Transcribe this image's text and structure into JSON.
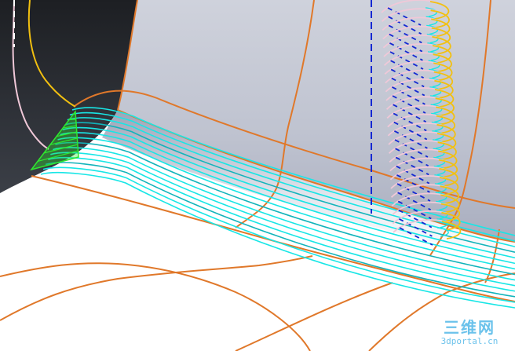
{
  "viewport": {
    "background": "#ffffff",
    "colors": {
      "void_dark": "#2b2e33",
      "wall_light": "#c9ccd6",
      "wall_shadow": "#9ea3b6",
      "edge": "#e0782a",
      "toolpath": "#18e6e6",
      "toolpath_dark": "#12b4bb",
      "entry_arc": "#f2c010",
      "pink_path": "#f0c8d8",
      "tool_axis": "#1428d2",
      "corner_cut": "#2ee82e"
    },
    "icons": [
      "gouge-check-arcs-icon",
      "tool-axis-icon",
      "corner-cleanup-icon"
    ]
  },
  "watermark": {
    "logo": "三维网",
    "domain": "3dportal.cn"
  }
}
